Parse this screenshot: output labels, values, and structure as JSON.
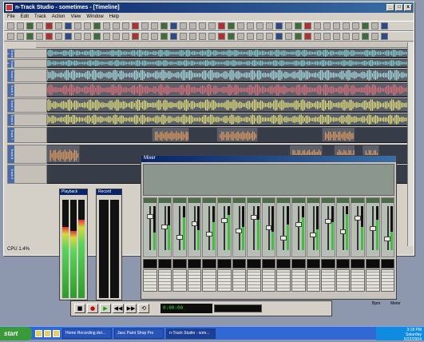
{
  "window": {
    "title": "n-Track Studio - sometimes - [Timeline]"
  },
  "menu": [
    "File",
    "Edit",
    "Track",
    "Action",
    "View",
    "Window",
    "Help"
  ],
  "status": "CPU 1.4%",
  "tracks": [
    {
      "name": "Track 1",
      "color": "#7fd6d6",
      "label": "",
      "clip": true
    },
    {
      "name": "Track 2",
      "color": "#7fd6d6",
      "label": "",
      "clip": true
    },
    {
      "name": "Track 3",
      "color": "#a8e0e0",
      "label": "",
      "clip": true
    },
    {
      "name": "Track 4",
      "color": "#e0707a",
      "label": "",
      "clip": true
    },
    {
      "name": "Track 5",
      "color": "#e8e478",
      "label": "",
      "clip": true
    },
    {
      "name": "Track 6",
      "color": "#e8e478",
      "label": "",
      "clip": true
    },
    {
      "name": "Track 7",
      "color": "#e39a5a",
      "label": "",
      "clip": false
    },
    {
      "name": "Track 8",
      "color": "#e39a5a",
      "label": "",
      "clip": false
    },
    {
      "name": "Track 9",
      "color": "#6070c0",
      "label": "",
      "clip": false
    }
  ],
  "vu": [
    {
      "title": "Playback",
      "levels": [
        0.72,
        0.68,
        0.8
      ]
    },
    {
      "title": "Record"
    }
  ],
  "mixer": {
    "title": "Mixer",
    "channels": 17
  },
  "transport": {
    "time": "0:00:00",
    "bpm": "Bpm",
    "meter": "Meter"
  },
  "taskbar": {
    "start": "start",
    "tasks": [
      "Home Recording dot...",
      "Jasc Paint Shop Pro",
      "n-Track Studio - som..."
    ],
    "clock": [
      "3:18 PM",
      "Saturday",
      "5/22/2004"
    ]
  },
  "colors": {
    "titlebar": "#0a246a",
    "taskbar": "#3168d5"
  }
}
